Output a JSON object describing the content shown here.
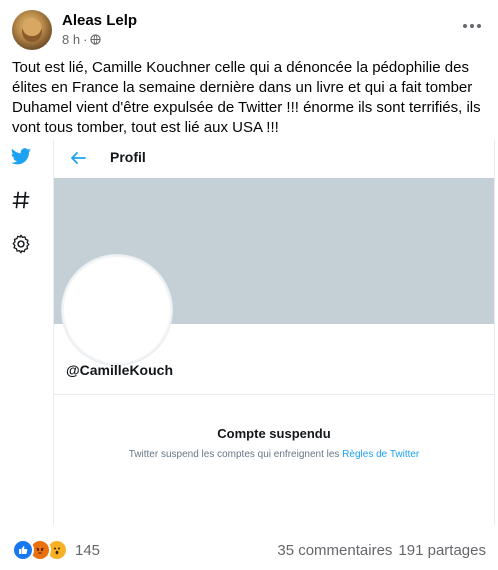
{
  "post": {
    "author": "Aleas Lelp",
    "time": "8 h",
    "separator": "·",
    "text": "Tout est lié, Camille Kouchner celle qui a dénoncée la pédophilie des élites en France la semaine dernière dans un livre et qui a fait tomber Duhamel vient d'être expulsée de Twitter !!! énorme ils sont terrifiés, ils vont tous tomber, tout est lié aux USA !!!"
  },
  "twitter": {
    "header_title": "Profil",
    "handle": "@CamilleKouch",
    "suspend_title": "Compte suspendu",
    "suspend_text": "Twitter suspend les comptes qui enfreignent les",
    "rules_link": "Règles de Twitter",
    "rail_icons": [
      "twitter-bird-icon",
      "hashtag-icon",
      "settings-icon"
    ],
    "colors": {
      "accent": "#1da1f2",
      "banner": "#c4cfd6"
    }
  },
  "footer": {
    "reaction_icons": [
      "like-icon",
      "angry-icon",
      "wow-icon"
    ],
    "reaction_count": "145",
    "comments": "35 commentaires",
    "shares": "191 partages"
  }
}
